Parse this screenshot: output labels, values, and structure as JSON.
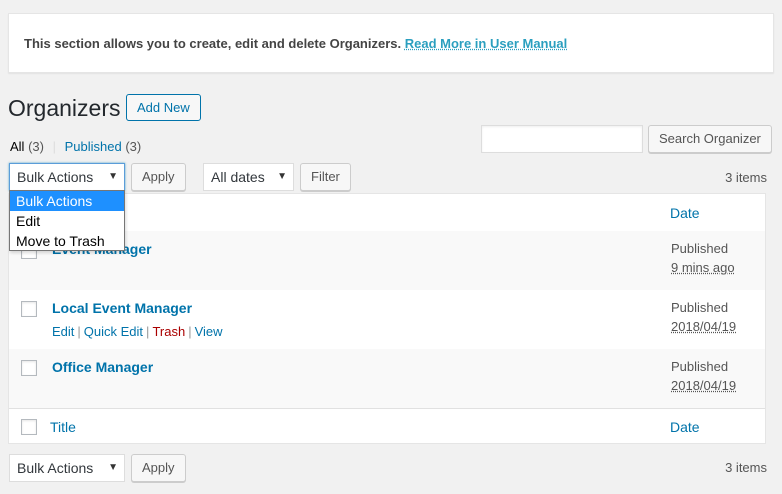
{
  "notice": {
    "text": "This section allows you to create, edit and delete Organizers.",
    "link": "Read More in User Manual"
  },
  "page_title": "Organizers",
  "add_new_label": "Add New",
  "views": {
    "all_label": "All",
    "all_count": "(3)",
    "published_label": "Published",
    "published_count": "(3)",
    "separator": "|"
  },
  "search": {
    "button_label": "Search Organizer",
    "value": ""
  },
  "bulk_top": {
    "selected": "Bulk Actions",
    "options": [
      "Bulk Actions",
      "Edit",
      "Move to Trash"
    ],
    "apply_label": "Apply"
  },
  "dates_filter": {
    "selected": "All dates",
    "filter_label": "Filter"
  },
  "items_count": "3 items",
  "table": {
    "header_date": "Date",
    "footer_title": "Title",
    "footer_date": "Date",
    "rows": [
      {
        "title": "Event Manager",
        "status": "Published",
        "date": "9 mins ago"
      },
      {
        "title": "Local Event Manager",
        "status": "Published",
        "date": "2018/04/19",
        "actions": [
          "Edit",
          "Quick Edit",
          "Trash",
          "View"
        ]
      },
      {
        "title": "Office Manager",
        "status": "Published",
        "date": "2018/04/19"
      }
    ]
  },
  "bulk_bottom": {
    "selected": "Bulk Actions",
    "apply_label": "Apply"
  },
  "icons": {
    "select_arrow": "▼"
  },
  "colors": {
    "link": "#0073aa",
    "trash": "#a00",
    "selected_option": "#1e90ff"
  }
}
